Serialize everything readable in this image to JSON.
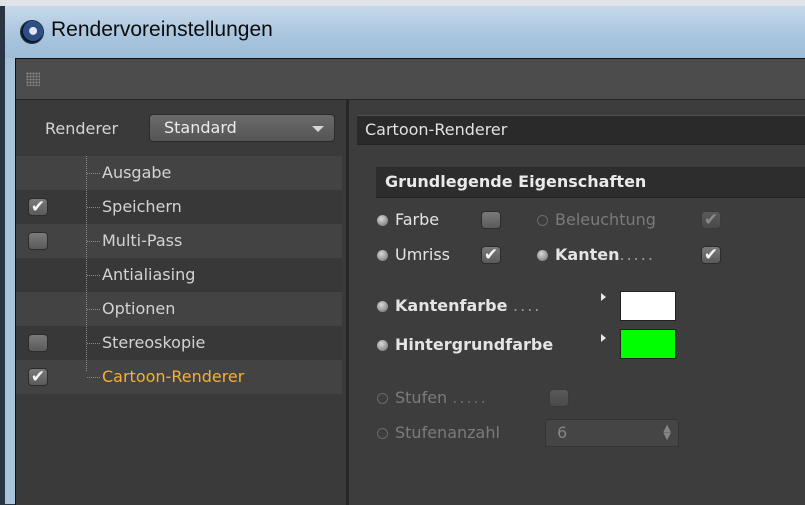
{
  "window": {
    "title": "Rendervoreinstellungen"
  },
  "renderer": {
    "label": "Renderer",
    "value": "Standard"
  },
  "tree": [
    {
      "label": "Ausgabe",
      "checkbox": "none",
      "active": false
    },
    {
      "label": "Speichern",
      "checkbox": "checked",
      "active": false
    },
    {
      "label": "Multi-Pass",
      "checkbox": "unchecked",
      "active": false
    },
    {
      "label": "Antialiasing",
      "checkbox": "none",
      "active": false
    },
    {
      "label": "Optionen",
      "checkbox": "none",
      "active": false
    },
    {
      "label": "Stereoskopie",
      "checkbox": "unchecked",
      "active": false
    },
    {
      "label": "Cartoon-Renderer",
      "checkbox": "checked",
      "active": true
    }
  ],
  "panel": {
    "title": "Cartoon-Renderer",
    "section": "Grundlegende Eigenschaften",
    "farbe": {
      "label": "Farbe",
      "checked": false
    },
    "beleuchtung": {
      "label": "Beleuchtung",
      "checked": true,
      "enabled": false
    },
    "umriss": {
      "label": "Umriss",
      "checked": true
    },
    "kanten": {
      "label": "Kanten",
      "dots": ".....",
      "checked": true
    },
    "kantenfarbe": {
      "label": "Kantenfarbe",
      "dots": "....",
      "color": "#ffffff"
    },
    "hintergrundfarbe": {
      "label": "Hintergrundfarbe",
      "color": "#00ff00"
    },
    "stufen": {
      "label": "Stufen",
      "dots": ".....",
      "checked": false,
      "enabled": false
    },
    "stufenanzahl": {
      "label": "Stufenanzahl",
      "value": "6",
      "enabled": false
    }
  },
  "icons": {
    "checkmark": "✔"
  },
  "colors": {
    "active_tree_item": "#f4b030",
    "titlebar": "#aac6df"
  }
}
